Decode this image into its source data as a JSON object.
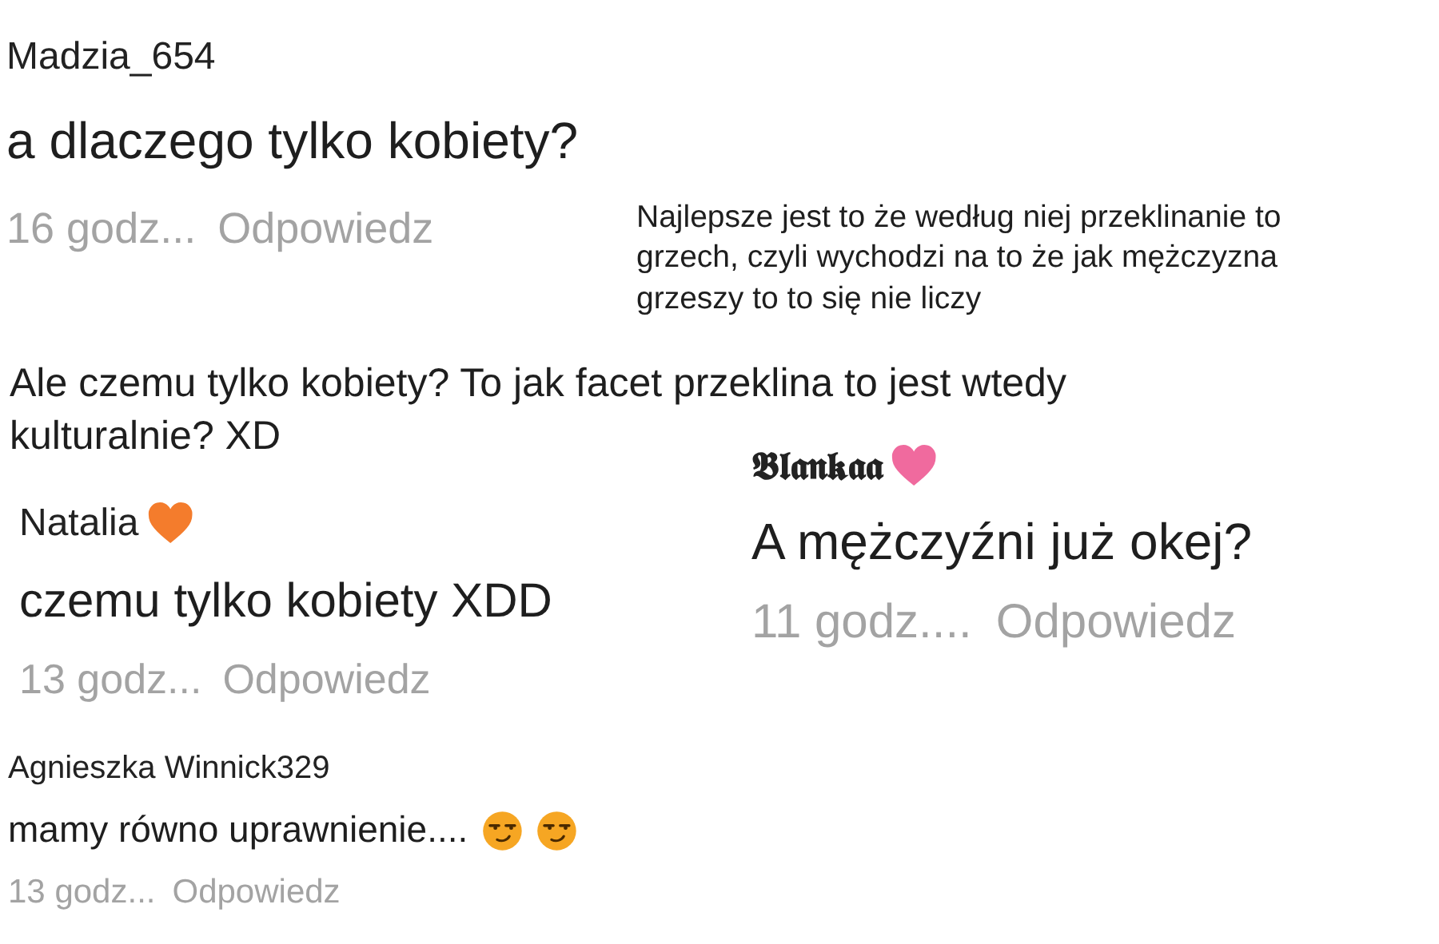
{
  "clippings": [
    {
      "kind": "full",
      "user": "Madzia_654",
      "text": "a dlaczego tylko kobiety?",
      "emoji_after": false,
      "time": "16 godz...",
      "reply": "Odpowiedz"
    },
    {
      "kind": "text",
      "text": "Najlepsze jest to że według niej przeklinanie to grzech, czyli wychodzi na to że jak mężczyzna grzeszy to to się nie liczy",
      "emoji_after": false
    },
    {
      "kind": "text",
      "text": "Ale czemu tylko kobiety? To jak facet przeklina to jest wtedy kulturalnie? XD",
      "emoji_after": false
    },
    {
      "kind": "full",
      "user": "Natalia",
      "color": "#f47c2c",
      "text": "czemu tylko kobiety XDD",
      "emoji_after": false,
      "time": "13 godz...",
      "reply": "Odpowiedz"
    },
    {
      "kind": "full",
      "user": "𝕭𝖑𝖆𝖓𝖐𝖆𝖆",
      "color": "#f06a9e",
      "text": "A mężczyźni już okej?",
      "emoji_after": false,
      "time": "11 godz....",
      "reply": "Odpowiedz"
    },
    {
      "kind": "full",
      "user": "Agnieszka Winnick329",
      "text": "mamy równo uprawnienie....",
      "emoji_after": true,
      "time": "13 godz...",
      "reply": "Odpowiedz"
    }
  ]
}
